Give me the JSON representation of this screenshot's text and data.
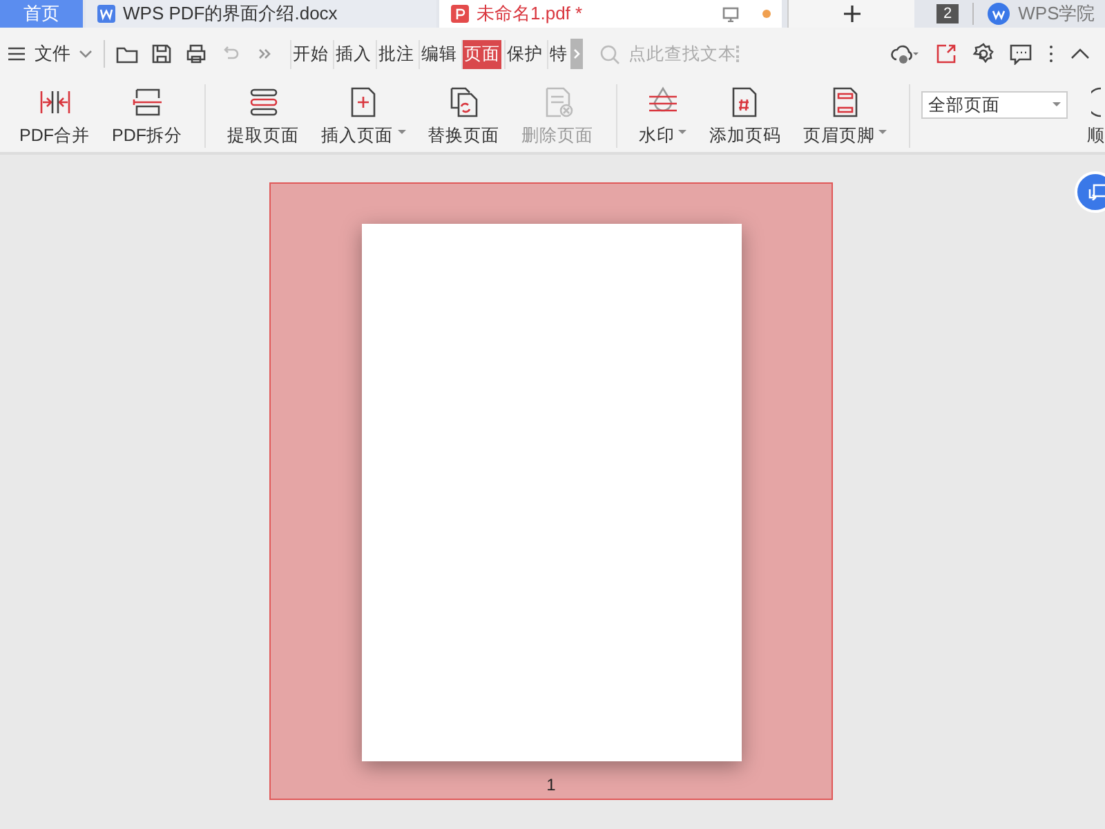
{
  "tabs": [
    {
      "label": "首页",
      "kind": "home",
      "selected": false
    },
    {
      "label": "WPS PDF的界面介绍.docx",
      "kind": "doc",
      "selected": false
    },
    {
      "label": "未命名1.pdf *",
      "kind": "pdf",
      "selected": true
    }
  ],
  "tab_count": "2",
  "account": "WPS学院",
  "menu": {
    "label": "文件"
  },
  "menu_tabs": [
    {
      "label": "开始",
      "selected": false
    },
    {
      "label": "插入",
      "selected": false
    },
    {
      "label": "批注",
      "selected": false
    },
    {
      "label": "编辑",
      "selected": false
    },
    {
      "label": "页面",
      "selected": true
    },
    {
      "label": "保护",
      "selected": false
    },
    {
      "label": "特",
      "selected": false
    }
  ],
  "search": {
    "placeholder": "点此查找文本"
  },
  "ribbon_groups": [
    {
      "buttons": [
        {
          "label": "PDF合并",
          "kind": "merge",
          "dropdown": false,
          "disabled": false
        },
        {
          "label": "PDF拆分",
          "kind": "split",
          "dropdown": false,
          "disabled": false
        }
      ]
    },
    {
      "buttons": [
        {
          "label": "提取页面",
          "kind": "extract",
          "dropdown": false,
          "disabled": false
        },
        {
          "label": "插入页面",
          "kind": "insert",
          "dropdown": true,
          "disabled": false
        },
        {
          "label": "替换页面",
          "kind": "replace",
          "dropdown": false,
          "disabled": false
        },
        {
          "label": "删除页面",
          "kind": "delete",
          "dropdown": false,
          "disabled": true
        }
      ]
    },
    {
      "buttons": [
        {
          "label": "水印",
          "kind": "watermark",
          "dropdown": true,
          "disabled": false
        },
        {
          "label": "添加页码",
          "kind": "pagenum",
          "dropdown": false,
          "disabled": false
        },
        {
          "label": "页眉页脚",
          "kind": "headerfooter",
          "dropdown": true,
          "disabled": false
        }
      ]
    }
  ],
  "page_range": {
    "value": "全部页面"
  },
  "cut_button": {
    "label": "顺"
  },
  "document": {
    "page_number": "1",
    "selected": true
  }
}
